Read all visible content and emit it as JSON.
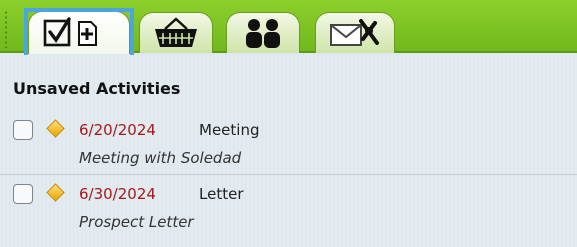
{
  "tabs": [
    {
      "icon": "checklist-add-icon",
      "active": true
    },
    {
      "icon": "basket-icon",
      "active": false
    },
    {
      "icon": "people-icon",
      "active": false
    },
    {
      "icon": "mail-icon",
      "active": false
    }
  ],
  "section": {
    "title": "Unsaved Activities"
  },
  "activities": [
    {
      "date": "6/20/2024",
      "type": "Meeting",
      "description": "Meeting with Soledad",
      "checked": false
    },
    {
      "date": "6/30/2024",
      "type": "Letter",
      "description": "Prospect Letter",
      "checked": false
    }
  ],
  "colors": {
    "tabbar": "#7cc224",
    "date": "#a31919",
    "focus": "#4aa6dd",
    "priority": "#f0a500"
  }
}
